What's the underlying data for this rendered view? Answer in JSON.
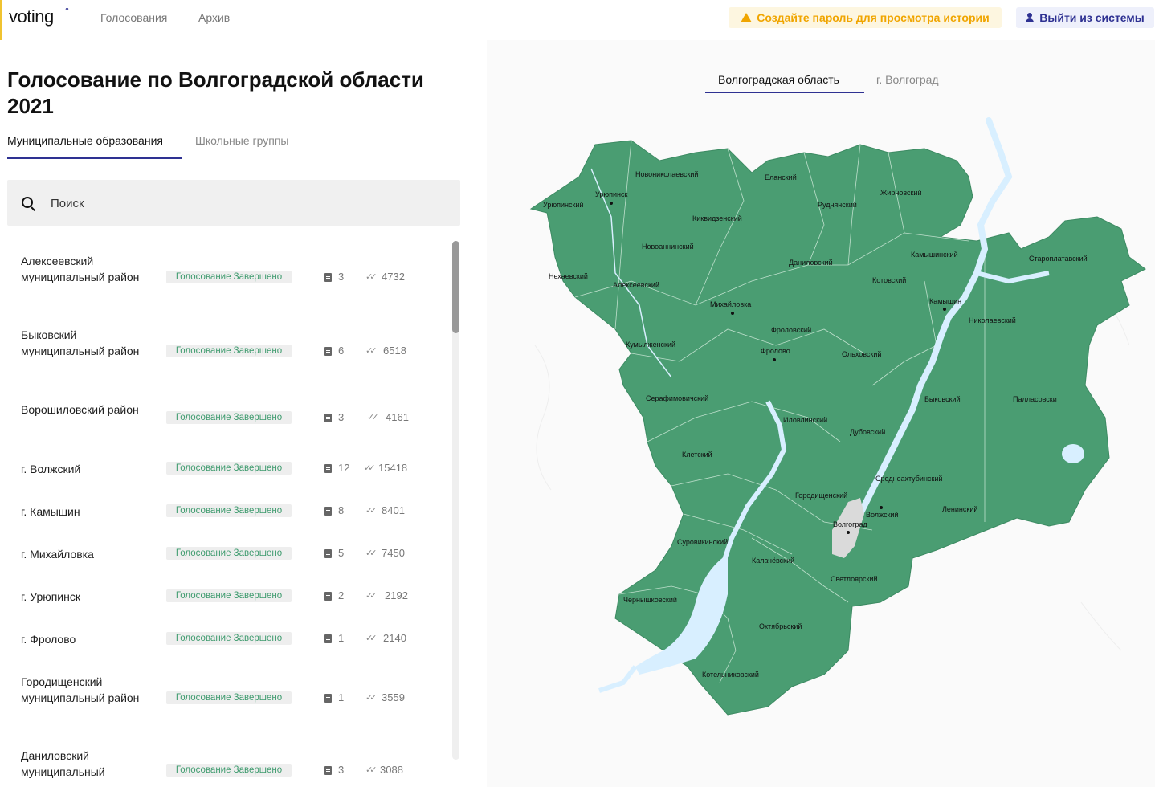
{
  "header": {
    "logo": "voting",
    "logo_mark": "“",
    "nav": [
      "Голосования",
      "Архив"
    ],
    "warning_button": "Создайте пароль для просмотра истории",
    "logout_button": "Выйти из системы"
  },
  "page": {
    "title": "Голосование по Волгоградской области 2021",
    "tabs": [
      "Муниципальные образования",
      "Школьные группы"
    ],
    "search_placeholder": "Поиск"
  },
  "list": [
    {
      "name": "Алексеевский муниципальный район",
      "status": "Голосование Завершено",
      "docs": "3",
      "votes": "4732"
    },
    {
      "name": "Быковский муниципальный район",
      "status": "Голосование Завершено",
      "docs": "6",
      "votes": "6518"
    },
    {
      "name": "Ворошиловский район",
      "status": "Голосование Завершено",
      "docs": "3",
      "votes": "4161"
    },
    {
      "name": "г. Волжский",
      "status": "Голосование Завершено",
      "docs": "12",
      "votes": "15418"
    },
    {
      "name": "г. Камышин",
      "status": "Голосование Завершено",
      "docs": "8",
      "votes": "8401"
    },
    {
      "name": "г. Михайловка",
      "status": "Голосование Завершено",
      "docs": "5",
      "votes": "7450"
    },
    {
      "name": "г. Урюпинск",
      "status": "Голосование Завершено",
      "docs": "2",
      "votes": "2192"
    },
    {
      "name": "г. Фролово",
      "status": "Голосование Завершено",
      "docs": "1",
      "votes": "2140"
    },
    {
      "name": "Городищенский муниципальный район",
      "status": "Голосование Завершено",
      "docs": "1",
      "votes": "3559"
    },
    {
      "name": "Даниловский муниципальный",
      "status": "Голосование Завершено",
      "docs": "3",
      "votes": "3088"
    }
  ],
  "map": {
    "tabs": [
      "Волгоградская область",
      "г. Волгоград"
    ],
    "region_color": "#4a9d72",
    "river_color": "#d8efff",
    "city_color": "#dadada",
    "labels": [
      "Новониколаевский",
      "Еланский",
      "Урюпинск",
      "Жирновский",
      "Урюпинский",
      "Руднянский",
      "Киквидзенский",
      "Новоаннинский",
      "Камышинский",
      "Староплатавский",
      "Даниловский",
      "Нехаевский",
      "Алексеевский",
      "Котовский",
      "Камышин",
      "Михайловка",
      "Николаевский",
      "Фроловский",
      "Кумылженский",
      "Фролово",
      "Ольховский",
      "Серафимовичский",
      "Быковский",
      "Палласовски",
      "Иловлинский",
      "Дубовский",
      "Клетский",
      "Среднеахтубинский",
      "Городищенский",
      "Ленинский",
      "Волжский",
      "Волгоград",
      "Суровикинский",
      "Калачёвский",
      "Светлоярский",
      "Чернышковский",
      "Октябрьский",
      "Котельниковский"
    ]
  }
}
